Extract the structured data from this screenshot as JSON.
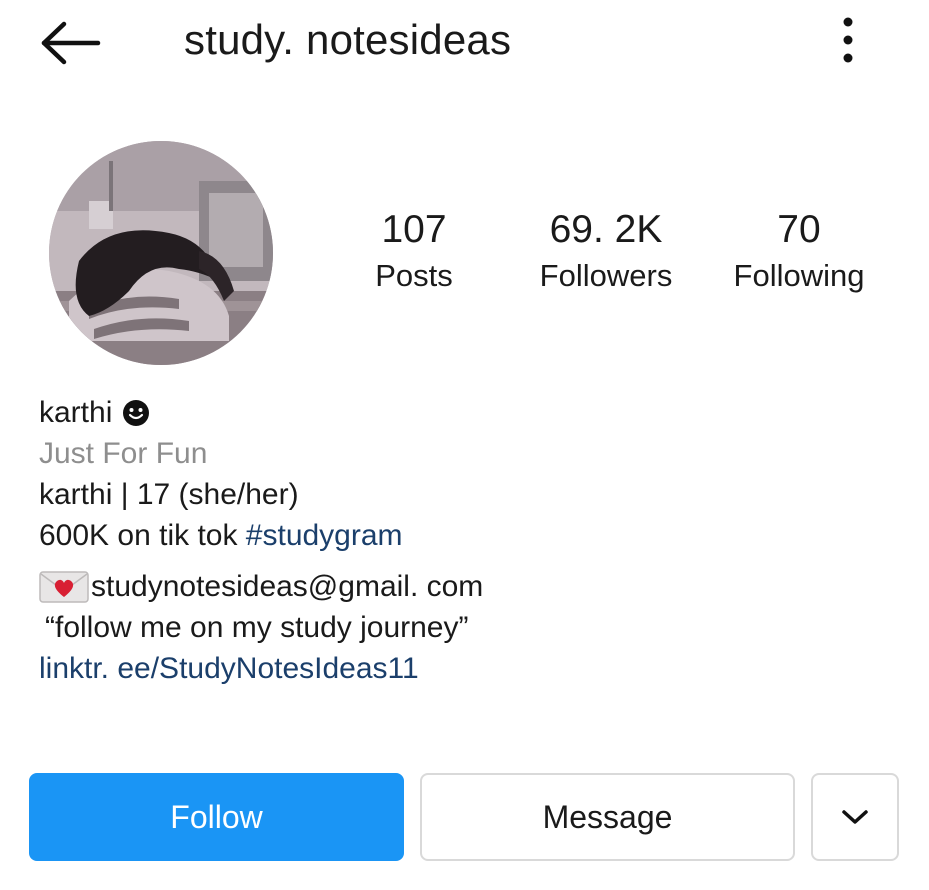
{
  "header": {
    "username": "study. notesideas",
    "back_icon": "arrow-left-icon",
    "more_icon": "more-vertical-icon"
  },
  "profile": {
    "avatar_icon": "profile-avatar"
  },
  "stats": [
    {
      "value": "107",
      "label": "Posts"
    },
    {
      "value": "69. 2K",
      "label": "Followers"
    },
    {
      "value": "70",
      "label": "Following"
    }
  ],
  "bio": {
    "name": "karthi",
    "category": "Just For Fun",
    "line1": "karthi | 17 (she/her)",
    "line2_text": "600K on tik tok ",
    "line2_hashtag": "#studygram",
    "email": "studynotesideas@gmail. com",
    "quote": "“follow me on my study journey”",
    "link": "linktr. ee/StudyNotesIdeas11"
  },
  "actions": {
    "follow_label": "Follow",
    "message_label": "Message",
    "more_icon": "chevron-down-icon"
  },
  "colors": {
    "accent": "#1a95f5",
    "link": "#1b3f6b",
    "muted": "#8e8e8e"
  }
}
